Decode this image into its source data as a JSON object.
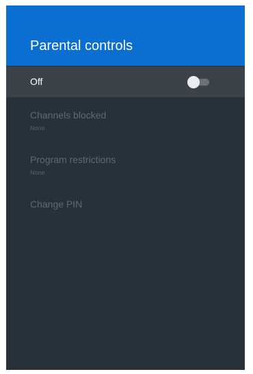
{
  "header": {
    "title": "Parental controls"
  },
  "toggle": {
    "label": "Off",
    "state": "off"
  },
  "menu": {
    "items": [
      {
        "title": "Channels blocked",
        "subtitle": "None"
      },
      {
        "title": "Program restrictions",
        "subtitle": "None"
      },
      {
        "title": "Change PIN"
      }
    ]
  },
  "colors": {
    "header_background": "#0a6fd0",
    "panel_background": "#263238",
    "selected_row": "#3b4348"
  }
}
